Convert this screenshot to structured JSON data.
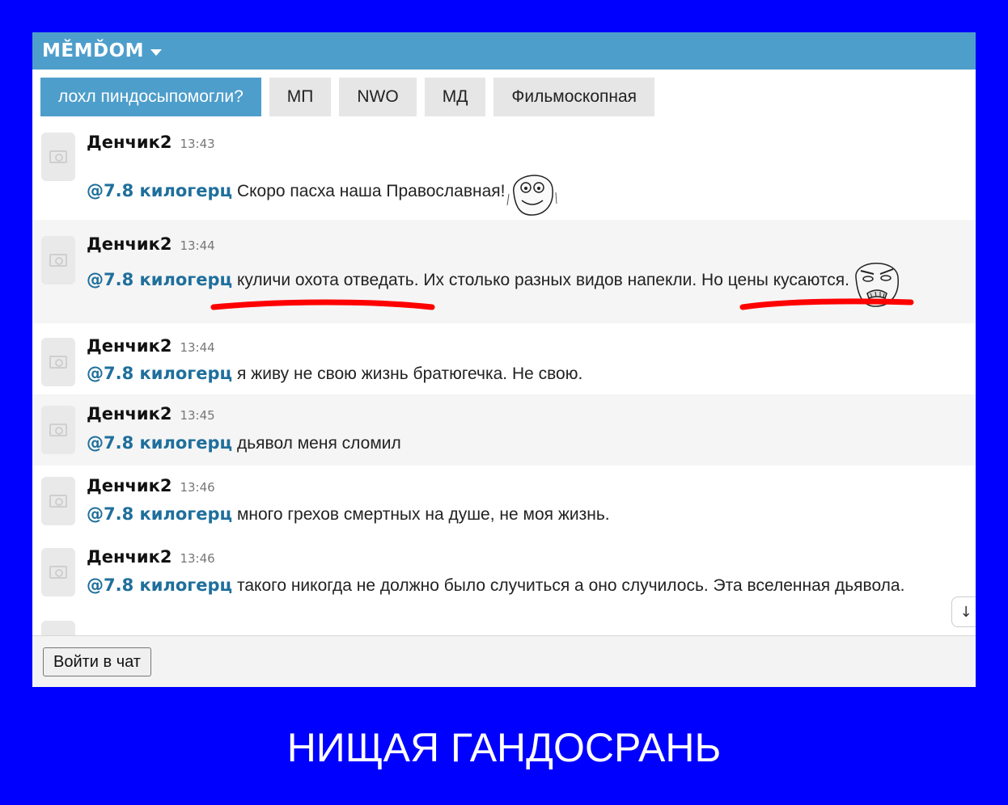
{
  "header": {
    "brand": "MĚMĎOM"
  },
  "tabs": [
    {
      "label": "лохл пиндосыпомогли?",
      "active": true
    },
    {
      "label": "МП",
      "active": false
    },
    {
      "label": "NWO",
      "active": false
    },
    {
      "label": "МД",
      "active": false
    },
    {
      "label": "Фильмоскопная",
      "active": false
    }
  ],
  "messages": [
    {
      "author": "Денчик2",
      "time": "13:43",
      "mention": "@7.8 килогерц",
      "text": "Скоро пасха наша Православная!"
    },
    {
      "author": "Денчик2",
      "time": "13:44",
      "mention": "@7.8 килогерц",
      "text": "куличи охота отведать. Их столько разных видов напекли. Но цены кусаются."
    },
    {
      "author": "Денчик2",
      "time": "13:44",
      "mention": "@7.8 килогерц",
      "text": "я живу не свою жизнь братюгечка. Не свою."
    },
    {
      "author": "Денчик2",
      "time": "13:45",
      "mention": "@7.8 килогерц",
      "text": "дьявол меня сломил"
    },
    {
      "author": "Денчик2",
      "time": "13:46",
      "mention": "@7.8 килогерц",
      "text": "много грехов смертных на душе, не моя жизнь."
    },
    {
      "author": "Денчик2",
      "time": "13:46",
      "mention": "@7.8 килогерц",
      "text": "такого никогда не должно было случиться а оно случилось. Эта вселенная дьявола."
    }
  ],
  "scroll_icon": "arrow-down-icon",
  "footer": {
    "login_label": "Войти в чат"
  },
  "caption": "НИЩАЯ ГАНДОСРАНЬ",
  "colors": {
    "background": "#0000ff",
    "header": "#4e9ecb",
    "mention": "#1f6f9c",
    "annotation": "#ff0000"
  }
}
